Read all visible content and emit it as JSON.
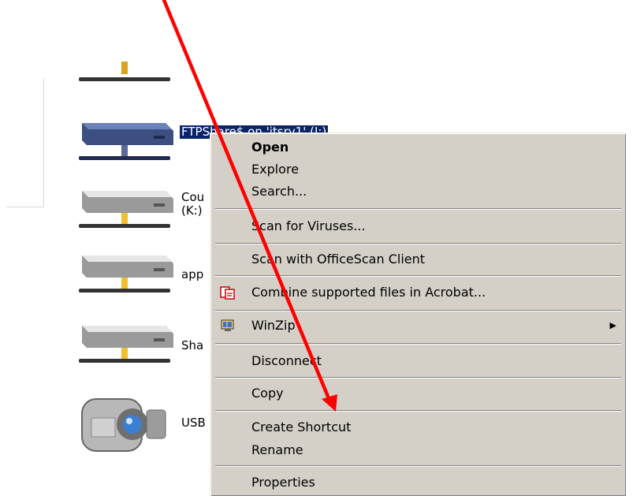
{
  "drives": [
    {
      "name": "network-drive-partial",
      "label": ""
    },
    {
      "name": "ftp-share-drive",
      "label": "FTPShare$ on 'itsrv1' (J:)"
    },
    {
      "name": "network-drive-k",
      "label": "Cou\n(K:)"
    },
    {
      "name": "network-drive-app",
      "label": "app"
    },
    {
      "name": "network-drive-sha",
      "label": "Sha"
    },
    {
      "name": "usb-camera-drive",
      "label": "USB"
    }
  ],
  "context_menu": {
    "items": [
      {
        "name": "menu-open",
        "label": "Open",
        "bold": true
      },
      {
        "name": "menu-explore",
        "label": "Explore"
      },
      {
        "name": "menu-search",
        "label": "Search..."
      },
      {
        "name": "menu-scan-viruses",
        "label": "Scan for Viruses..."
      },
      {
        "name": "menu-scan-officescan",
        "label": "Scan with OfficeScan Client"
      },
      {
        "name": "menu-combine-acrobat",
        "label": "Combine supported files in Acrobat...",
        "icon": "acrobat-icon"
      },
      {
        "name": "menu-winzip",
        "label": "WinZip",
        "icon": "winzip-icon",
        "submenu": true
      },
      {
        "name": "menu-disconnect",
        "label": "Disconnect"
      },
      {
        "name": "menu-copy",
        "label": "Copy"
      },
      {
        "name": "menu-create-shortcut",
        "label": "Create Shortcut"
      },
      {
        "name": "menu-rename",
        "label": "Rename"
      },
      {
        "name": "menu-properties",
        "label": "Properties"
      }
    ],
    "submenu_arrow": "▶"
  },
  "colors": {
    "selection": "#0a246a",
    "menu_bg": "#d4d0c8",
    "annotation_arrow": "#ff0000"
  }
}
